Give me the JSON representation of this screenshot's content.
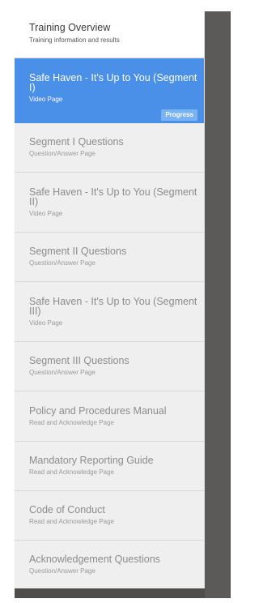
{
  "nav": {
    "overview": {
      "title": "Training Overview",
      "sub": "Training information and results"
    },
    "items": [
      {
        "title": "Safe Haven - It's Up to You (Segment I)",
        "sub": "Video Page",
        "badge": "Progress"
      },
      {
        "title": "Segment I Questions",
        "sub": "Question/Answer Page"
      },
      {
        "title": "Safe Haven - It's Up to You (Segment II)",
        "sub": "Video Page"
      },
      {
        "title": "Segment II Questions",
        "sub": "Question/Answer Page"
      },
      {
        "title": "Safe Haven - It's Up to You (Segment III)",
        "sub": "Video Page"
      },
      {
        "title": "Segment III Questions",
        "sub": "Question/Answer Page"
      },
      {
        "title": "Policy and Procedures Manual",
        "sub": "Read and Acknowledge Page"
      },
      {
        "title": "Mandatory Reporting Guide",
        "sub": "Read and Acknowledge Page"
      },
      {
        "title": "Code of Conduct",
        "sub": "Read and Acknowledge Page"
      },
      {
        "title": "Acknowledgement Questions",
        "sub": "Question/Answer Page"
      }
    ]
  },
  "colors": {
    "active": "#4a8fe8",
    "badge": "#7ab3f3",
    "frame": "#5b5a58"
  }
}
